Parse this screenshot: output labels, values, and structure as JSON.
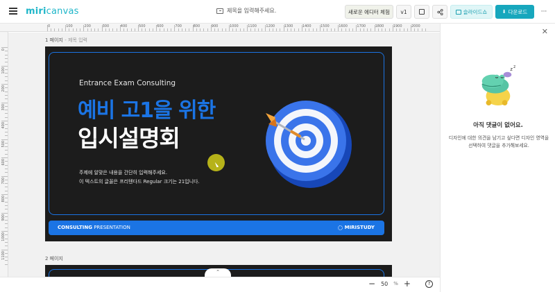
{
  "header": {
    "logo_bold": "miri",
    "logo_rest": "canvas",
    "doc_title": "제목을 입력해주세요.",
    "new_editor_label": "새로운 에디터 체험",
    "version_label": "v1",
    "slides_label": "슬라이드쇼",
    "download_label": "다운로드",
    "more_label": "···"
  },
  "ruler": {
    "top": [
      "0",
      "100",
      "200",
      "300",
      "400",
      "500",
      "600",
      "700",
      "800",
      "900",
      "1000",
      "1100",
      "1200",
      "1300",
      "1400",
      "1500",
      "1600",
      "1700",
      "1800",
      "1900",
      "2000"
    ],
    "left": [
      "0",
      "100",
      "200",
      "300",
      "400",
      "500",
      "600",
      "700",
      "800",
      "900",
      "1000",
      "1100"
    ]
  },
  "pages": [
    {
      "label": "1 페이지",
      "sub": " - 제목 입력"
    },
    {
      "label": "2 페이지",
      "sub": ""
    }
  ],
  "slide": {
    "eng_title": "Entrance Exam Consulting",
    "heading_blue": "예비 고1을 위한",
    "heading_white": "입시설명회",
    "desc_line1": "주제에 알맞은 내용을 간단히 입력해주세요.",
    "desc_line2": "이 텍스트의 글꼴은 프리텐다드 Regular 크기는 21입니다.",
    "bar_left_bold": "CONSULTING",
    "bar_left_light": " PRESENTATION",
    "bar_right": "MIRISTUDY"
  },
  "zoom": {
    "value": "50",
    "unit": "%"
  },
  "comments": {
    "empty_title": "아직 댓글이 없어요.",
    "empty_desc": "디자인에 대한 의견을 남기고 싶다면 디자인 영역을 선택하여 댓글을 추가해보세요."
  },
  "colors": {
    "brand": "#17a7bd",
    "slide_accent": "#1b74e4",
    "slide_bg": "#1c1c1c"
  }
}
